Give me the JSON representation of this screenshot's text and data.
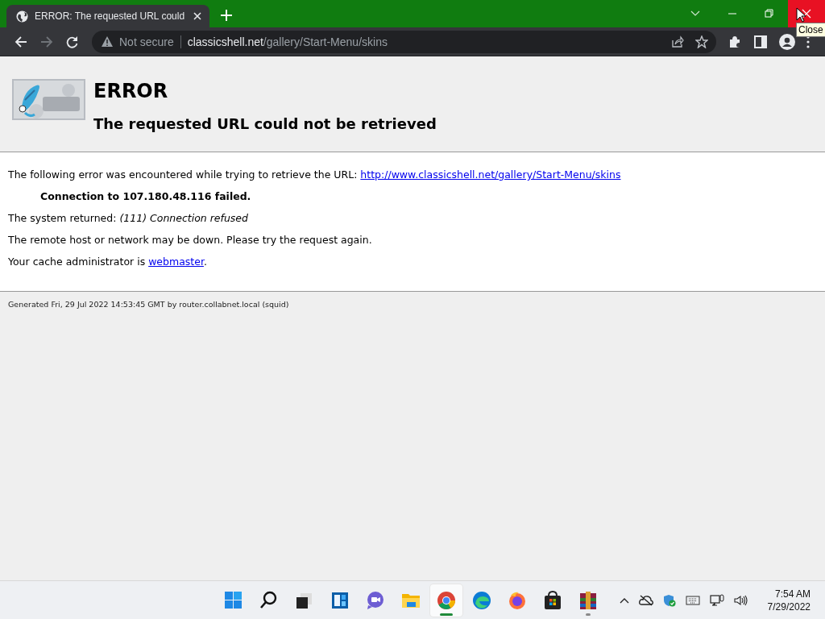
{
  "tab": {
    "title": "ERROR: The requested URL could",
    "selected": true
  },
  "window_controls": [
    {
      "kind": "tab-search",
      "hovered": false
    },
    {
      "kind": "minimize",
      "hovered": false
    },
    {
      "kind": "restore",
      "hovered": false
    },
    {
      "kind": "close",
      "hovered": true
    }
  ],
  "tooltip": "Close",
  "nav_buttons": [
    {
      "kind": "back",
      "disabled": false
    },
    {
      "kind": "forward",
      "disabled": true
    },
    {
      "kind": "reload",
      "disabled": false
    }
  ],
  "address_bar": {
    "security": "Not secure",
    "domain": "classicshell.net",
    "path": "/gallery/Start-Menu/skins"
  },
  "page": {
    "heading": "ERROR",
    "subheading": "The requested URL could not be retrieved",
    "intro": "The following error was encountered while trying to retrieve the URL: ",
    "url": "http://www.classicshell.net/gallery/Start-Menu/skins",
    "failure": "Connection to 107.180.48.116 failed.",
    "system_returned": "The system returned: *(111) Connection refused*",
    "remote": "The remote host or network may be down. Please try the request again.",
    "admin": "Your cache administrator is ",
    "admin_link": "webmaster",
    "admin_end": ".",
    "footer": "Generated Fri, 29 Jul 2022 14:53:45 GMT by router.collabnet.local (squid)"
  },
  "taskbar_apps": [
    {
      "kind": "start",
      "active": false,
      "running": false
    },
    {
      "kind": "search",
      "active": false,
      "running": false
    },
    {
      "kind": "task-view",
      "active": false,
      "running": false
    },
    {
      "kind": "widgets",
      "active": false,
      "running": false
    },
    {
      "kind": "chat",
      "active": false,
      "running": false
    },
    {
      "kind": "files",
      "active": false,
      "running": false
    },
    {
      "kind": "chrome",
      "active": true,
      "running": true
    },
    {
      "kind": "edge",
      "active": false,
      "running": false
    },
    {
      "kind": "firefox",
      "active": false,
      "running": false
    },
    {
      "kind": "store",
      "active": false,
      "running": false
    },
    {
      "kind": "archive",
      "active": false,
      "running": true
    }
  ],
  "clock": {
    "time": "7:54 AM",
    "date": "7/29/2022"
  }
}
